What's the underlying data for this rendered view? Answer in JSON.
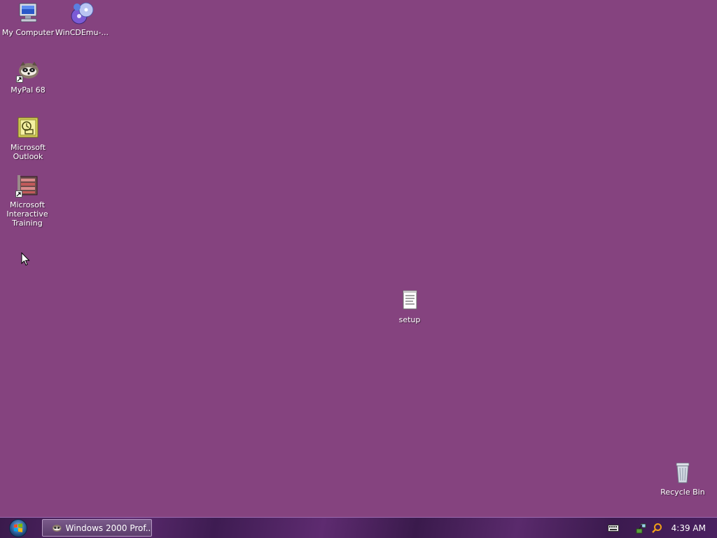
{
  "desktop": {
    "background_color": "#85437f",
    "icons": {
      "my_computer": {
        "label": "My Computer",
        "icon": "my-computer-icon"
      },
      "wincdemu": {
        "label": "WinCDEmu-...",
        "icon": "cd-disc-icon"
      },
      "mypal": {
        "label": "MyPal 68",
        "icon": "raccoon-browser-icon"
      },
      "outlook": {
        "label": "Microsoft\nOutlook",
        "icon": "outlook-clock-icon"
      },
      "interactive_training": {
        "label": "Microsoft\nInteractive\nTraining",
        "icon": "training-film-icon"
      },
      "setup": {
        "label": "setup",
        "icon": "text-document-icon"
      },
      "recycle_bin": {
        "label": "Recycle Bin",
        "icon": "recycle-bin-icon"
      }
    }
  },
  "taskbar": {
    "start_icon": "windows-orb-icon",
    "task_button": {
      "label": "Windows 2000 Prof...",
      "icon": "raccoon-browser-icon"
    },
    "tray": {
      "icons": [
        "keyboard-icon",
        "network-icon",
        "search-icon"
      ],
      "clock": "4:39 AM"
    }
  }
}
